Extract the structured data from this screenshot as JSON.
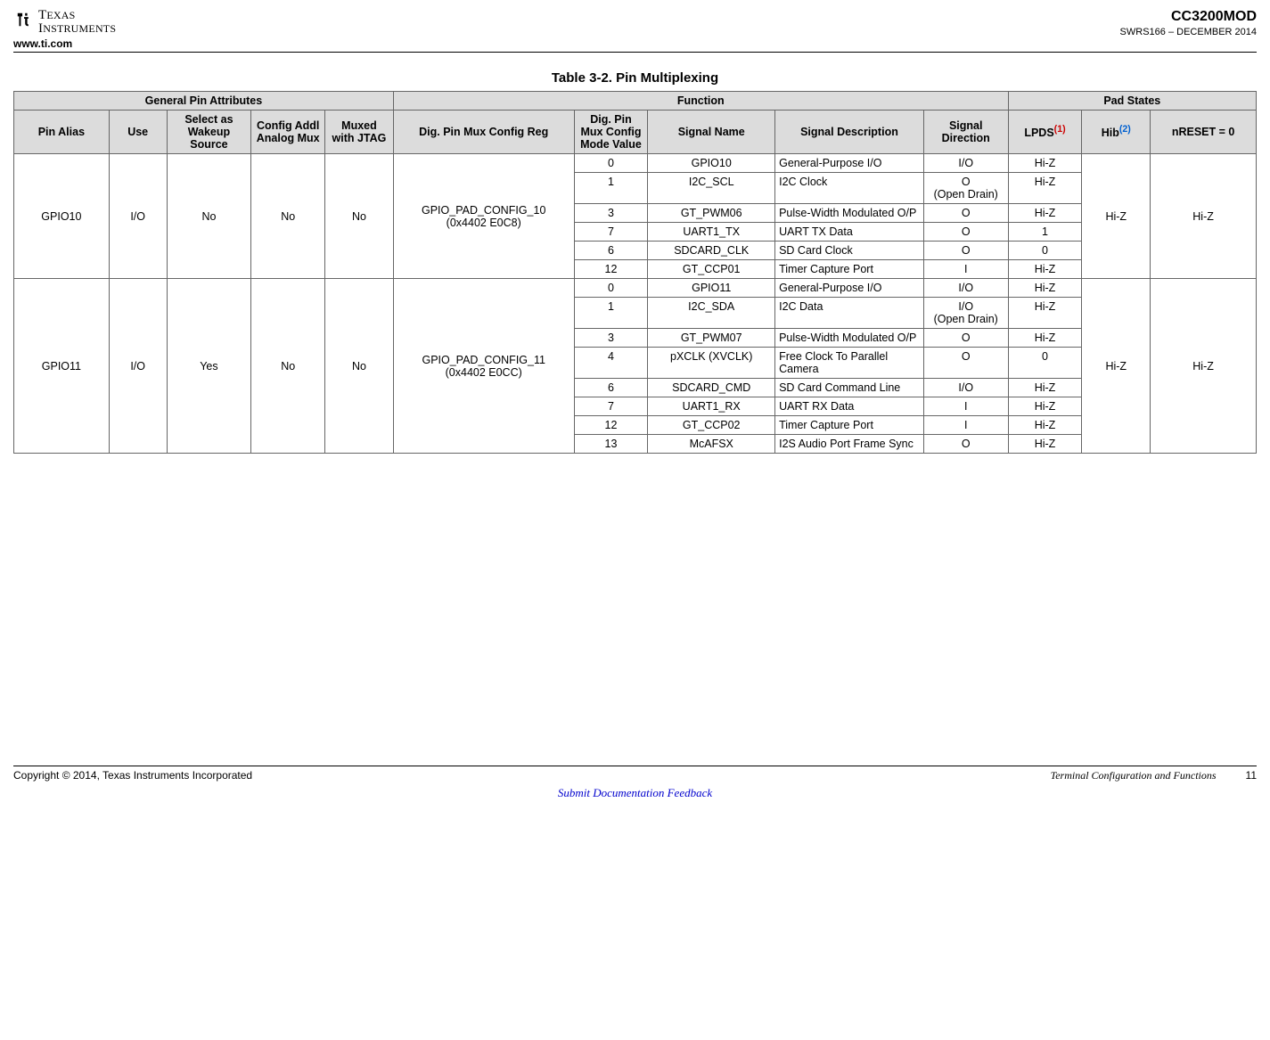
{
  "header": {
    "url": "www.ti.com",
    "partNumber": "CC3200MOD",
    "docId": "SWRS166 – DECEMBER 2014"
  },
  "tableTitle": "Table 3-2. Pin Multiplexing",
  "groupHeaders": {
    "general": "General Pin Attributes",
    "function": "Function",
    "padStates": "Pad States"
  },
  "columns": {
    "pinAlias": "Pin Alias",
    "use": "Use",
    "wakeup": "Select as Wakeup Source",
    "configAddl": "Config Addl Analog Mux",
    "muxedJtag": "Muxed with JTAG",
    "configReg": "Dig. Pin Mux Config Reg",
    "modeValue": "Dig. Pin Mux Config Mode Value",
    "signalName": "Signal Name",
    "signalDesc": "Signal Description",
    "signalDir": "Signal Direction",
    "lpds": "LPDS",
    "lpdsSup": "(1)",
    "hib": "Hib",
    "hibSup": "(2)",
    "nreset": "nRESET = 0"
  },
  "pins": [
    {
      "alias": "GPIO10",
      "use": "I/O",
      "wakeup": "No",
      "configAddl": "No",
      "muxedJtag": "No",
      "configRegLine1": "GPIO_PAD_CONFIG_10",
      "configRegLine2": "(0x4402 E0C8)",
      "hib": "Hi-Z",
      "nreset": "Hi-Z",
      "functions": [
        {
          "mode": "0",
          "name": "GPIO10",
          "desc": "General-Purpose I/O",
          "dir": "I/O",
          "lpds": "Hi-Z"
        },
        {
          "mode": "1",
          "name": "I2C_SCL",
          "desc": "I2C Clock",
          "dir": "O (Open Drain)",
          "lpds": "Hi-Z"
        },
        {
          "mode": "3",
          "name": "GT_PWM06",
          "desc": "Pulse-Width Modulated O/P",
          "dir": "O",
          "lpds": "Hi-Z"
        },
        {
          "mode": "7",
          "name": "UART1_TX",
          "desc": "UART TX Data",
          "dir": "O",
          "lpds": "1"
        },
        {
          "mode": "6",
          "name": "SDCARD_CLK",
          "desc": "SD Card Clock",
          "dir": "O",
          "lpds": "0"
        },
        {
          "mode": "12",
          "name": "GT_CCP01",
          "desc": "Timer Capture Port",
          "dir": "I",
          "lpds": "Hi-Z"
        }
      ]
    },
    {
      "alias": "GPIO11",
      "use": "I/O",
      "wakeup": "Yes",
      "configAddl": "No",
      "muxedJtag": "No",
      "configRegLine1": "GPIO_PAD_CONFIG_11",
      "configRegLine2": "(0x4402 E0CC)",
      "hib": "Hi-Z",
      "nreset": "Hi-Z",
      "functions": [
        {
          "mode": "0",
          "name": "GPIO11",
          "desc": "General-Purpose I/O",
          "dir": "I/O",
          "lpds": "Hi-Z"
        },
        {
          "mode": "1",
          "name": "I2C_SDA",
          "desc": "I2C Data",
          "dir": "I/O (Open Drain)",
          "lpds": "Hi-Z"
        },
        {
          "mode": "3",
          "name": "GT_PWM07",
          "desc": "Pulse-Width Modulated O/P",
          "dir": "O",
          "lpds": "Hi-Z"
        },
        {
          "mode": "4",
          "name": "pXCLK (XVCLK)",
          "desc": "Free Clock To Parallel Camera",
          "dir": "O",
          "lpds": "0"
        },
        {
          "mode": "6",
          "name": "SDCARD_CMD",
          "desc": "SD Card Command Line",
          "dir": "I/O",
          "lpds": "Hi-Z"
        },
        {
          "mode": "7",
          "name": "UART1_RX",
          "desc": "UART RX Data",
          "dir": "I",
          "lpds": "Hi-Z"
        },
        {
          "mode": "12",
          "name": "GT_CCP02",
          "desc": "Timer Capture Port",
          "dir": "I",
          "lpds": "Hi-Z"
        },
        {
          "mode": "13",
          "name": "McAFSX",
          "desc": "I2S Audio Port Frame Sync",
          "dir": "O",
          "lpds": "Hi-Z"
        }
      ]
    }
  ],
  "footer": {
    "copyright": "Copyright © 2014, Texas Instruments Incorporated",
    "section": "Terminal Configuration and Functions",
    "pageNum": "11",
    "feedback": "Submit Documentation Feedback"
  }
}
